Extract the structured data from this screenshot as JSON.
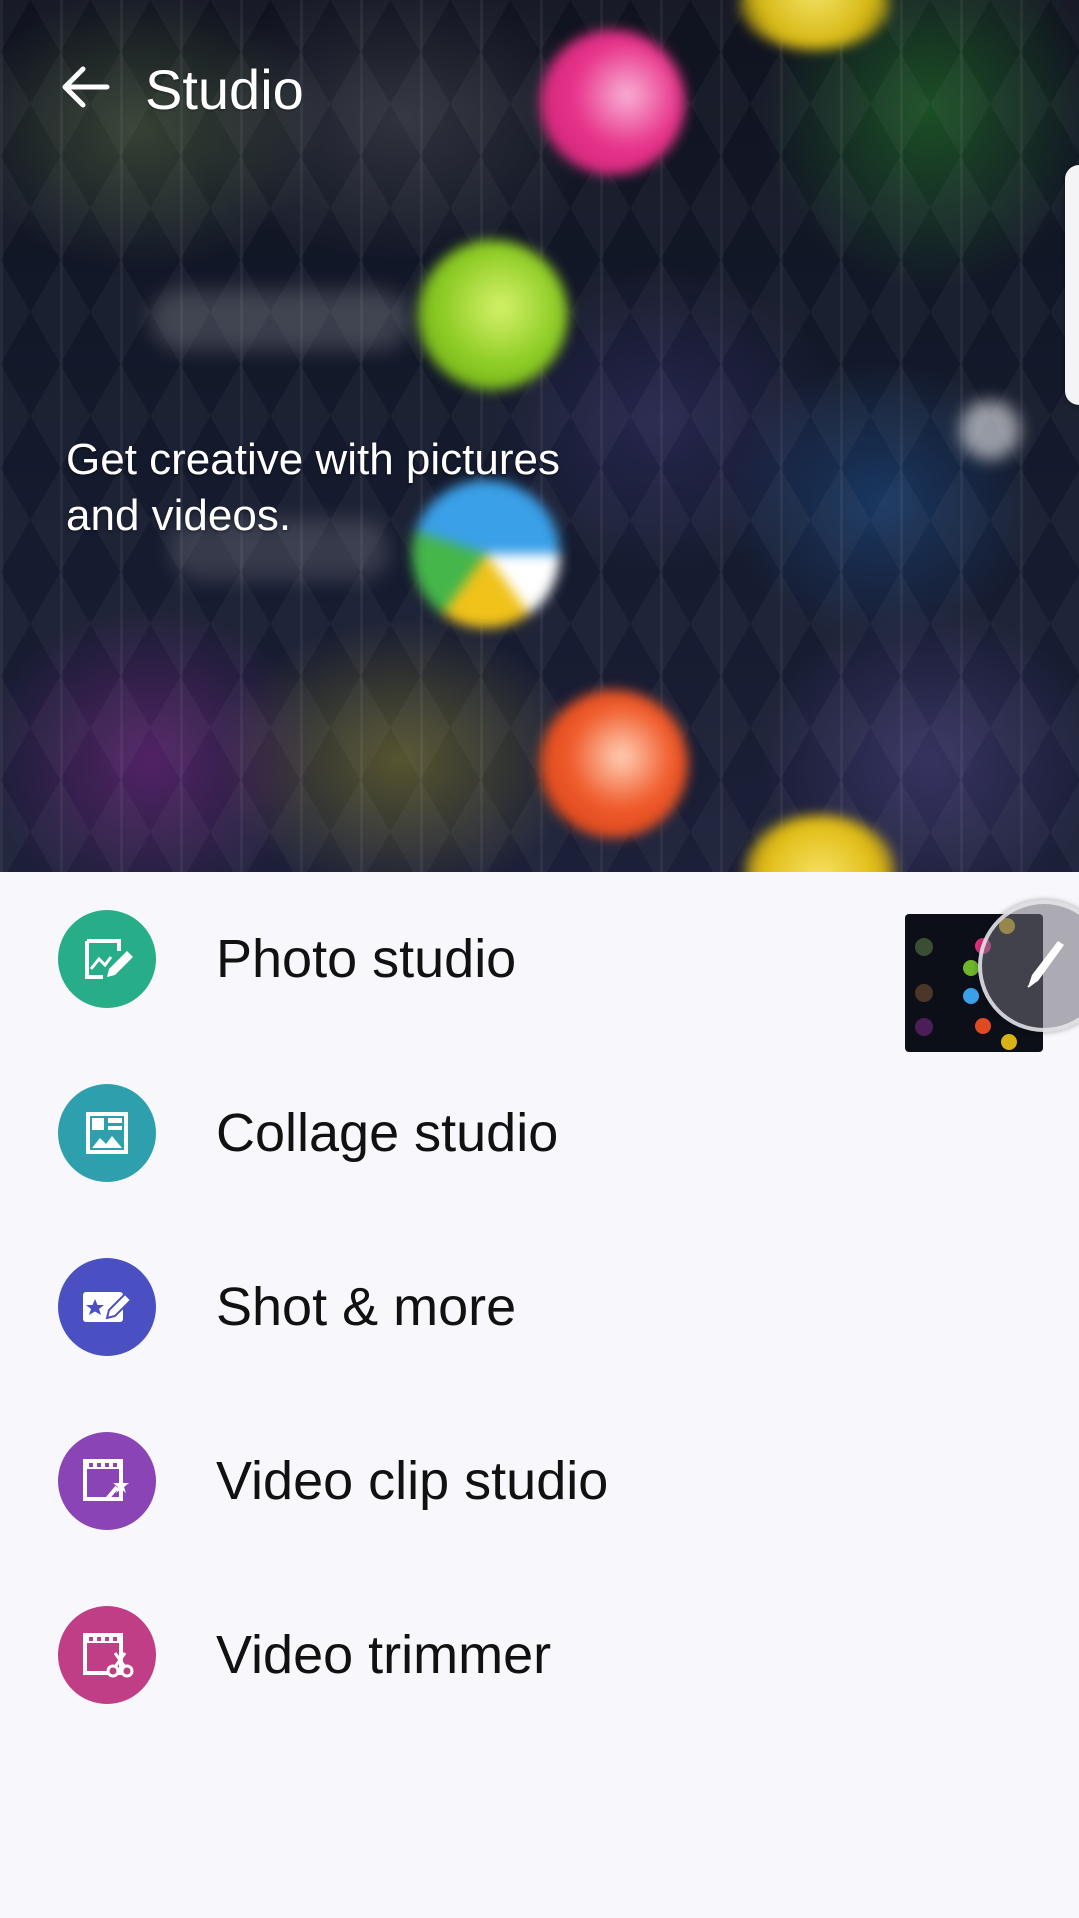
{
  "header": {
    "back_icon": "arrow-back-icon",
    "title": "Studio",
    "subtitle": "Get creative with pictures and videos."
  },
  "menu": {
    "items": [
      {
        "label": "Photo studio",
        "icon": "photo-edit-icon",
        "color": "#27ad87"
      },
      {
        "label": "Collage studio",
        "icon": "collage-icon",
        "color": "#2ea0ad"
      },
      {
        "label": "Shot & more",
        "icon": "shot-more-icon",
        "color": "#4a4fc2"
      },
      {
        "label": "Video clip studio",
        "icon": "video-clip-icon",
        "color": "#8a44b6"
      },
      {
        "label": "Video trimmer",
        "icon": "video-trim-icon",
        "color": "#bf3e86"
      }
    ]
  },
  "floating": {
    "thumbnail_icon": "screen-preview-thumbnail",
    "pen_icon": "pen-icon"
  },
  "colors": {
    "background": "#f8f7fb",
    "text": "#111111",
    "header_text": "#ffffff"
  }
}
